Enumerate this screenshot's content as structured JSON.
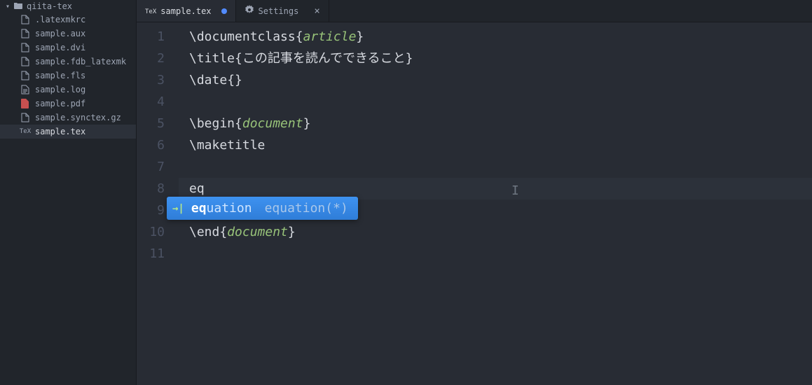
{
  "sidebar": {
    "folder": {
      "name": "qiita-tex"
    },
    "files": [
      {
        "name": ".latexmkrc",
        "icon": "file",
        "selected": false
      },
      {
        "name": "sample.aux",
        "icon": "file",
        "selected": false
      },
      {
        "name": "sample.dvi",
        "icon": "file",
        "selected": false
      },
      {
        "name": "sample.fdb_latexmk",
        "icon": "file",
        "selected": false
      },
      {
        "name": "sample.fls",
        "icon": "file",
        "selected": false
      },
      {
        "name": "sample.log",
        "icon": "log",
        "selected": false
      },
      {
        "name": "sample.pdf",
        "icon": "pdf",
        "selected": false
      },
      {
        "name": "sample.synctex.gz",
        "icon": "file",
        "selected": false
      },
      {
        "name": "sample.tex",
        "icon": "tex",
        "selected": true
      }
    ]
  },
  "tabs": [
    {
      "label": "sample.tex",
      "icon": "tex",
      "active": true,
      "modified": true
    },
    {
      "label": "Settings",
      "icon": "settings",
      "active": false,
      "closable": true
    }
  ],
  "editor": {
    "lines": [
      {
        "n": 1,
        "segments": [
          {
            "t": "\\documentclass",
            "c": "cmd"
          },
          {
            "t": "{",
            "c": "brace"
          },
          {
            "t": "article",
            "c": "arg"
          },
          {
            "t": "}",
            "c": "brace"
          }
        ]
      },
      {
        "n": 2,
        "segments": [
          {
            "t": "\\title",
            "c": "cmd"
          },
          {
            "t": "{",
            "c": "brace"
          },
          {
            "t": "この記事を読んでできること",
            "c": "text"
          },
          {
            "t": "}",
            "c": "brace"
          }
        ]
      },
      {
        "n": 3,
        "segments": [
          {
            "t": "\\date",
            "c": "cmd"
          },
          {
            "t": "{}",
            "c": "brace"
          }
        ]
      },
      {
        "n": 4,
        "segments": []
      },
      {
        "n": 5,
        "segments": [
          {
            "t": "\\begin",
            "c": "cmd"
          },
          {
            "t": "{",
            "c": "brace"
          },
          {
            "t": "document",
            "c": "arg"
          },
          {
            "t": "}",
            "c": "brace"
          }
        ]
      },
      {
        "n": 6,
        "segments": [
          {
            "t": "\\maketitle",
            "c": "cmd"
          }
        ]
      },
      {
        "n": 7,
        "segments": []
      },
      {
        "n": 8,
        "segments": [
          {
            "t": "eq",
            "c": "text"
          }
        ],
        "current": true
      },
      {
        "n": 9,
        "segments": []
      },
      {
        "n": 10,
        "segments": [
          {
            "t": "\\end",
            "c": "cmd"
          },
          {
            "t": "{",
            "c": "brace"
          },
          {
            "t": "document",
            "c": "arg"
          },
          {
            "t": "}",
            "c": "brace"
          }
        ]
      },
      {
        "n": 11,
        "segments": []
      }
    ]
  },
  "autocomplete": {
    "match": "eq",
    "rest": "uation",
    "hint": "equation(*)"
  }
}
